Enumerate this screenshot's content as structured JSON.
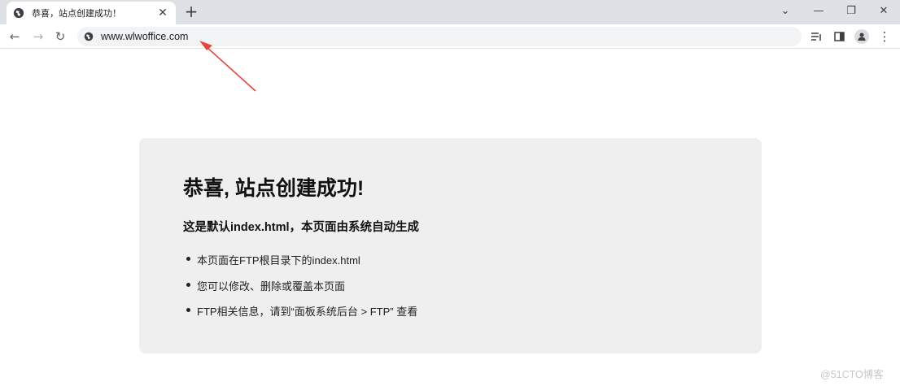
{
  "browser": {
    "tab": {
      "title": "恭喜，站点创建成功！",
      "close_glyph": "✕",
      "favicon": "globe-icon"
    },
    "new_tab_glyph": "+",
    "window_controls": {
      "tab_search": "⌄",
      "minimize": "—",
      "restore": "❐",
      "close": "✕"
    },
    "nav": {
      "back": "←",
      "forward": "→",
      "reload": "↻"
    },
    "omnibox": {
      "url": "www.wlwoffice.com",
      "site_icon": "globe-icon"
    },
    "toolbar_icons": [
      "reading-list-icon",
      "side-panel-icon",
      "profile-icon",
      "menu-icon"
    ],
    "menu_glyph": "⋮"
  },
  "page": {
    "title": "恭喜, 站点创建成功!",
    "subtitle": "这是默认index.html，本页面由系统自动生成",
    "items": [
      "本页面在FTP根目录下的index.html",
      "您可以修改、删除或覆盖本页面",
      "FTP相关信息，请到“面板系统后台 > FTP” 查看"
    ]
  },
  "annotation": {
    "arrow_color": "#e8443a"
  },
  "watermark": "@51CTO博客"
}
